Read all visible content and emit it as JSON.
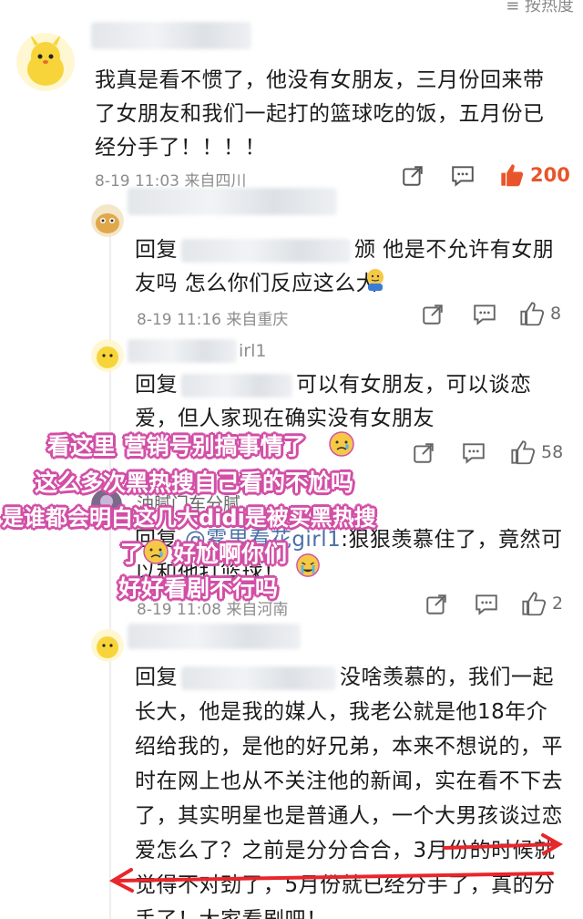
{
  "sort_label": "≡ 按热度",
  "comment_main": {
    "text": "我真是看不惯了，他没有女朋友，三月份回来带了女朋友和我们一起打的篮球吃的饭，五月份已经分手了！！！！",
    "meta": "8-19 11:03 来自四川",
    "likes": "200"
  },
  "replies": [
    {
      "prefix": "回复",
      "text": "颁 他是不允许有女朋友吗 怎么你们反应这么大",
      "meta": "8-19 11:16 来自重庆",
      "likes": "8"
    },
    {
      "username_tail": "irl1",
      "prefix": "回复",
      "text": "可以有女朋友，可以谈恋爱，但人家现在确实没有女朋友",
      "meta": "",
      "likes": "58"
    },
    {
      "username": "油腻门车分腻",
      "prefix": "回复",
      "mention": "@雾里看花girl1",
      "text": ":狠狠羡慕住了，竟然可以和他打篮球！",
      "meta": "8-19 11:08 来自河南",
      "likes": "2"
    },
    {
      "prefix": "回复",
      "text": "没啥羡慕的，我们一起长大，他是我的媒人，我老公就是他18年介绍给我的，是他的好兄弟，本来不想说的，平时在网上也从不关注他的新闻，实在看不下去了，其实明星也是普通人，一个大男孩谈过恋爱怎么了？之前是分分合合，3月份的时候就觉得不对劲了，5月份就已经分手了，真的分手了！大家看剧吧！"
    }
  ],
  "overlay_lines": [
    "看这里 营销号别搞事情了",
    "这么多次黑热搜自己看的不尬吗",
    "是谁都会明白这几大didi是被买黑热搜",
    "了",
    "好尬啊你们",
    "好好看剧不行吗"
  ],
  "colors": {
    "accent_like": "#e8552a",
    "overlay_outline": "#d24fa6",
    "annotation_arrow": "#e8262c"
  },
  "icons": [
    "share-icon",
    "comment-icon",
    "thumbs-up-icon",
    "avatar-icon",
    "emoji-icon"
  ]
}
